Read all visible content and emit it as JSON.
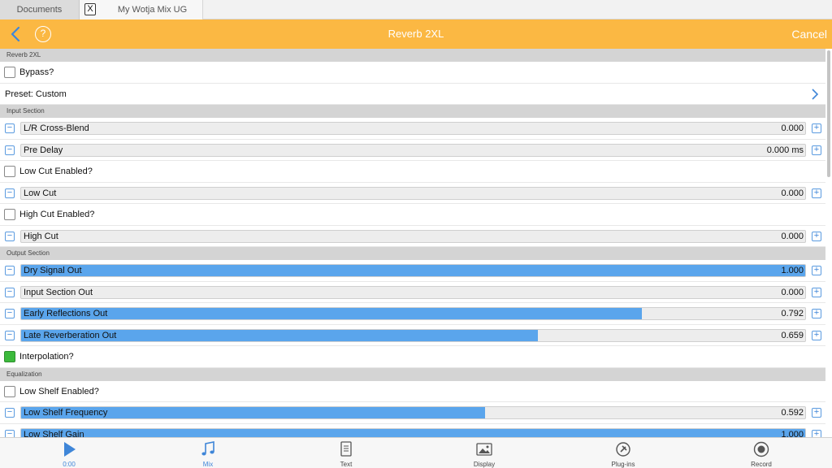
{
  "tabs": {
    "documents": "Documents",
    "close": "X",
    "mix": "My Wotja Mix UG"
  },
  "header": {
    "title": "Reverb 2XL",
    "help": "?",
    "cancel": "Cancel"
  },
  "colors": {
    "accent": "#fbb843",
    "slider_fill": "#5aa5ec",
    "checkbox_on": "#3cba3c",
    "link_blue": "#3f86d8"
  },
  "rows": [
    {
      "type": "section",
      "label": "Reverb 2XL"
    },
    {
      "type": "checkbox",
      "label": "Bypass?",
      "checked": false
    },
    {
      "type": "link",
      "label": "Preset: Custom"
    },
    {
      "type": "section",
      "label": "Input Section"
    },
    {
      "type": "slider",
      "label": "L/R Cross-Blend",
      "value": "0.000",
      "fill": 0
    },
    {
      "type": "slider",
      "label": "Pre Delay",
      "value": "0.000 ms",
      "fill": 0
    },
    {
      "type": "checkbox",
      "label": "Low Cut Enabled?",
      "checked": false
    },
    {
      "type": "slider",
      "label": "Low Cut",
      "value": "0.000",
      "fill": 0
    },
    {
      "type": "checkbox",
      "label": "High Cut Enabled?",
      "checked": false
    },
    {
      "type": "slider",
      "label": "High Cut",
      "value": "0.000",
      "fill": 0
    },
    {
      "type": "section",
      "label": "Output Section"
    },
    {
      "type": "slider",
      "label": "Dry Signal Out",
      "value": "1.000",
      "fill": 1.0
    },
    {
      "type": "slider",
      "label": "Input Section Out",
      "value": "0.000",
      "fill": 0
    },
    {
      "type": "slider",
      "label": "Early Reflections Out",
      "value": "0.792",
      "fill": 0.792
    },
    {
      "type": "slider",
      "label": "Late Reverberation Out",
      "value": "0.659",
      "fill": 0.659
    },
    {
      "type": "checkbox",
      "label": "Interpolation?",
      "checked": true
    },
    {
      "type": "section",
      "label": "Equalization"
    },
    {
      "type": "checkbox",
      "label": "Low Shelf Enabled?",
      "checked": false
    },
    {
      "type": "slider",
      "label": "Low Shelf Frequency",
      "value": "0.592",
      "fill": 0.592
    },
    {
      "type": "slider",
      "label": "Low Shelf Gain",
      "value": "1.000",
      "fill": 1.0
    }
  ],
  "toolbar": [
    {
      "id": "play",
      "label": "0:00",
      "icon": "play-icon",
      "active": true
    },
    {
      "id": "mix",
      "label": "Mix",
      "icon": "music-note-icon",
      "active": true
    },
    {
      "id": "text",
      "label": "Text",
      "icon": "document-icon",
      "active": false
    },
    {
      "id": "display",
      "label": "Display",
      "icon": "image-icon",
      "active": false
    },
    {
      "id": "plugins",
      "label": "Plug-ins",
      "icon": "plugin-icon",
      "active": false
    },
    {
      "id": "record",
      "label": "Record",
      "icon": "record-icon",
      "active": false
    }
  ]
}
